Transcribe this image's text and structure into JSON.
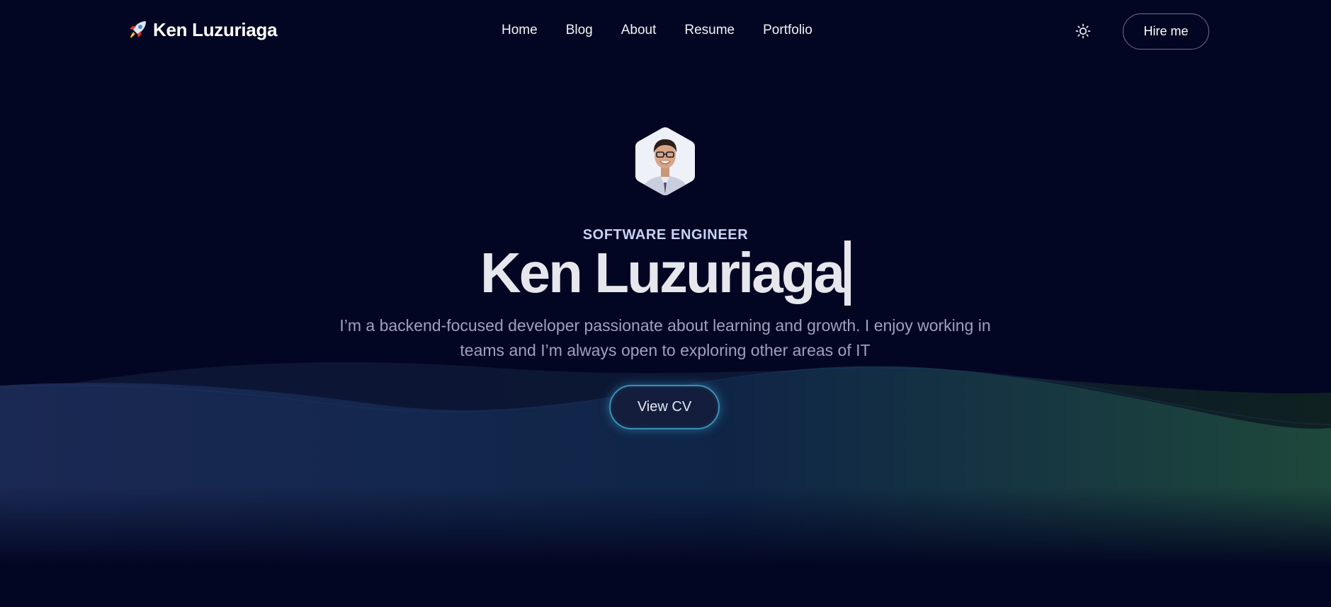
{
  "header": {
    "brand_name": "Ken Luzuriaga",
    "brand_icon": "rocket-icon",
    "nav": [
      {
        "label": "Home"
      },
      {
        "label": "Blog"
      },
      {
        "label": "About"
      },
      {
        "label": "Resume"
      },
      {
        "label": "Portfolio"
      }
    ],
    "theme_toggle_icon": "sun-icon",
    "hire_label": "Hire me"
  },
  "hero": {
    "avatar_icon": "profile-photo",
    "subtitle": "SOFTWARE ENGINEER",
    "title": "Ken Luzuriaga",
    "description": "I’m a backend-focused developer passionate about learning and growth. I enjoy working in teams and I’m always open to exploring other areas of IT",
    "cv_label": "View CV"
  },
  "colors": {
    "background": "#030622",
    "wave_blue": "#1b2a55",
    "wave_green": "#1f4a3c",
    "button_glow": "#3c8fb1"
  }
}
